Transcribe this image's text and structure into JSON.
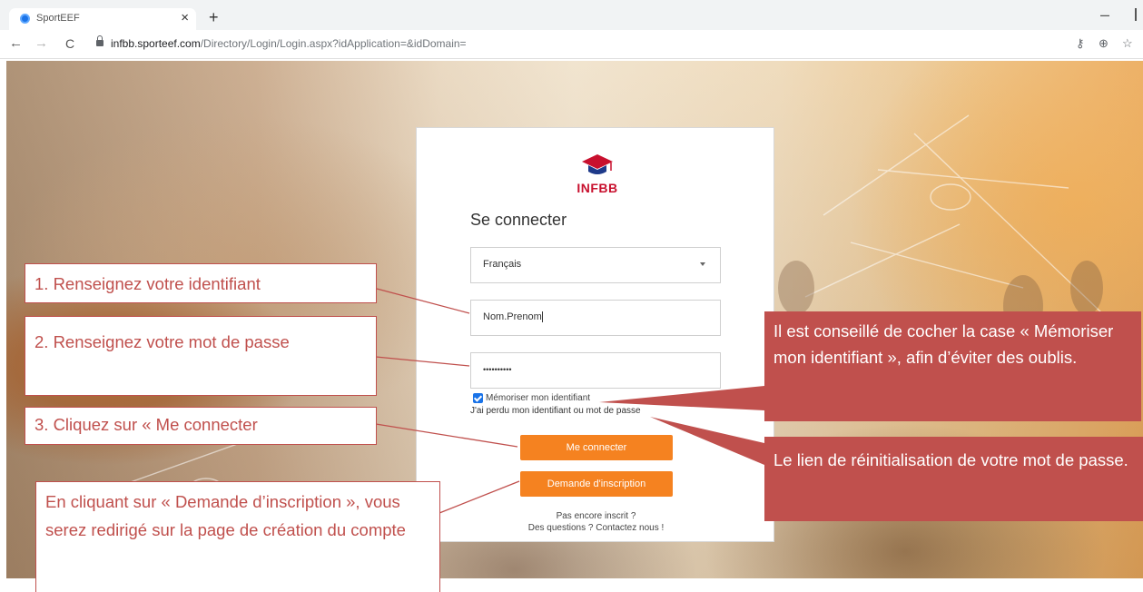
{
  "browser": {
    "tab_title": "SportEEF",
    "tab_close": "×",
    "new_tab": "+",
    "nav_back": "←",
    "nav_forward": "→",
    "nav_reload": "C",
    "url_host": "infbb.sporteef.com",
    "url_path": "/Directory/Login/Login.aspx?idApplication=&idDomain=",
    "minimize": "–",
    "icons": [
      "key-icon",
      "zoom-icon",
      "star-icon"
    ]
  },
  "login": {
    "logo_text": "INFBB",
    "title": "Se connecter",
    "language": "Français",
    "username_value": "Nom.Prenom",
    "password_mask": "••••••••••",
    "remember_label": "Mémoriser mon identifiant",
    "remember_checked": true,
    "forgot_link": "J'ai perdu mon identifiant ou mot de passe",
    "login_button": "Me connecter",
    "signup_button": "Demande d'inscription",
    "not_registered": "Pas encore inscrit ?",
    "contact": "Des questions ? Contactez nous !"
  },
  "callouts": {
    "step1": "1. Renseignez votre identifiant",
    "step2": "2. Renseignez votre mot de passe",
    "step3": "3. Cliquez sur « Me connecter",
    "signup_info": "En cliquant sur « Demande d’inscription », vous serez redirigé sur la page de création du compte",
    "remember_tip": "Il est conseillé de cocher la case « Mémoriser mon identifiant », afin d’éviter des oublis.",
    "reset_tip": "Le lien de réinitialisation de votre mot de passe."
  },
  "colors": {
    "accent_orange": "#f58220",
    "callout_red": "#c0504d",
    "logo_red": "#c8102e"
  }
}
